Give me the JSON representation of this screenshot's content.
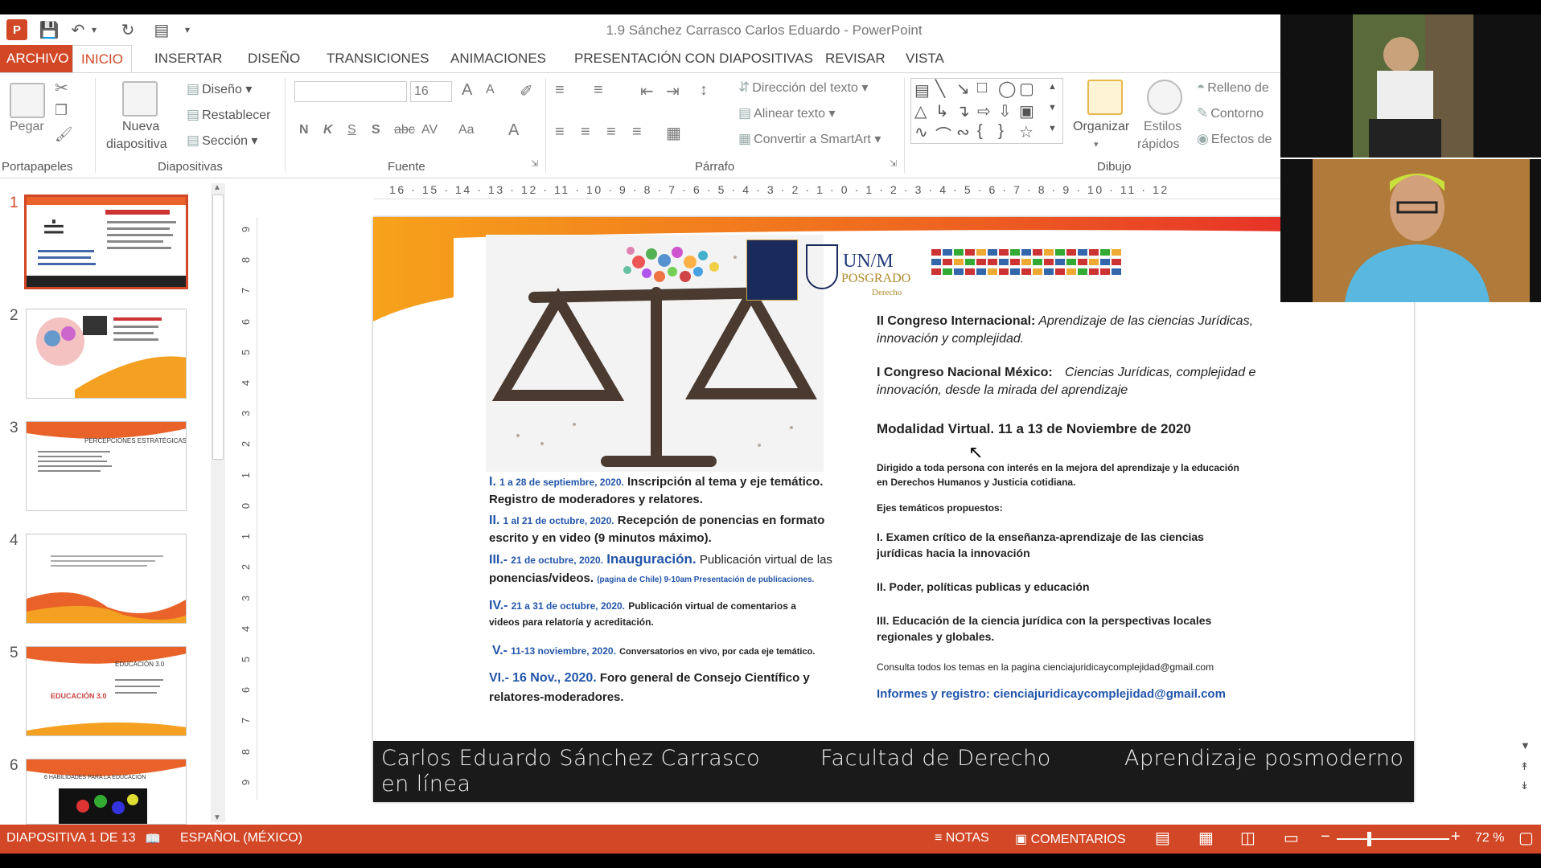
{
  "window": {
    "title": "1.9 Sánchez Carrasco Carlos Eduardo - PowerPoint",
    "app_icon": "P"
  },
  "tabs": [
    {
      "label": "ARCHIVO"
    },
    {
      "label": "INICIO"
    },
    {
      "label": "INSERTAR"
    },
    {
      "label": "DISEÑO"
    },
    {
      "label": "TRANSICIONES"
    },
    {
      "label": "ANIMACIONES"
    },
    {
      "label": "PRESENTACIÓN CON DIAPOSITIVAS"
    },
    {
      "label": "REVISAR"
    },
    {
      "label": "VISTA"
    }
  ],
  "ribbon": {
    "clipboard": {
      "paste": "Pegar",
      "label": "Portapapeles"
    },
    "slides": {
      "new_slide": "Nueva",
      "new_slide2": "diapositiva",
      "layout": "Diseño",
      "reset": "Restablecer",
      "section": "Sección",
      "label": "Diapositivas"
    },
    "font": {
      "size": "16",
      "bold": "N",
      "italic": "K",
      "underline": "S",
      "shadow": "S",
      "strike": "abc",
      "spacing": "AV",
      "case": "Aa",
      "color": "A",
      "grow": "A",
      "shrink": "A",
      "label": "Fuente"
    },
    "paragraph": {
      "text_direction": "Dirección del texto",
      "align_text": "Alinear texto",
      "smartart": "Convertir a SmartArt",
      "label": "Párrafo"
    },
    "drawing": {
      "arrange": "Organizar",
      "quick_styles": "Estilos",
      "quick_styles2": "rápidos",
      "fill": "Relleno de",
      "outline": "Contorno",
      "effects": "Efectos de",
      "label": "Dibujo"
    }
  },
  "ruler": {
    "horizontal": "16 · 15 · 14 · 13 · 12 · 11 · 10 · 9 · 8 · 7 · 6 · 5 · 4 · 3 · 2 · 1 · 0 · 1 · 2 · 3 · 4 · 5 · 6 · 7 · 8 · 9 · 10 · 11 · 12",
    "vertical": [
      "9",
      "8",
      "7",
      "6",
      "5",
      "4",
      "3",
      "2",
      "1",
      "0",
      "1",
      "2",
      "3",
      "4",
      "5",
      "6",
      "7",
      "8",
      "9"
    ]
  },
  "thumbnails": [
    {
      "num": "1"
    },
    {
      "num": "2"
    },
    {
      "num": "3"
    },
    {
      "num": "4"
    },
    {
      "num": "5"
    },
    {
      "num": "6"
    }
  ],
  "thumb_text": {
    "t3_title": "PERCEPCIONES ESTRATÉGICAS",
    "t5_title": "EDUCACIÓN 3.0",
    "t5_word": "EDUCACIÓN 3.0",
    "t6_title": "6 HABILIDADES PARA LA EDUCACIÓN"
  },
  "slide": {
    "logos": {
      "unam": "UN/M",
      "posgrado": "POSGRADO",
      "derecho": "Derecho"
    },
    "right": {
      "l1_bold": "II Congreso Internacional:",
      "l1_it": " Aprendizaje de las ciencias Jurídicas,",
      "l1_it2": "innovación y complejidad.",
      "l2_bold": "I Congreso Nacional México:",
      "l2_it": "Ciencias Jurídicas, complejidad e",
      "l2_it2": "innovación, desde la mirada del aprendizaje",
      "l3": "Modalidad Virtual. 11 a 13 de Noviembre de 2020",
      "l4a": "Dirigido a toda persona con interés en la mejora del aprendizaje y la educación",
      "l4b": "en Derechos Humanos y Justicia cotidiana.",
      "l5": "Ejes temáticos propuestos:",
      "l6a": "I. Examen crítico de la enseñanza-aprendizaje de las ciencias",
      "l6b": "jurídicas hacia la innovación",
      "l7": "II. Poder, políticas publicas y educación",
      "l8a": "III. Educación de la ciencia jurídica con la perspectivas locales",
      "l8b": "regionales y globales.",
      "l9": "Consulta todos los temas en la pagina cienciajuridicaycomplejidad@gmail.com",
      "l10": "Informes y registro: cienciajuridicaycomplejidad@gmail.com"
    },
    "left": {
      "i1_num": "I.",
      "i1_date": "1 a 28 de septiembre, 2020.",
      "i1_text": "Inscripción al tema y eje temático.",
      "i1_text2": "Registro de moderadores y relatores.",
      "i2_num": "II.",
      "i2_date": "1 al 21 de octubre, 2020.",
      "i2_text": "Recepción de ponencias en formato",
      "i2_text2": "escrito y en video (9 minutos máximo).",
      "i3_num": "III.-",
      "i3_date": "21 de octubre, 2020.",
      "i3_big": "Inauguración.",
      "i3_text": "Publicación virtual de las",
      "i3_text2": "ponencias/videos.",
      "i3_small": "(pagina de Chile) 9-10am Presentación de publicaciones.",
      "i4_num": "IV.-",
      "i4_date": "21 a 31 de octubre, 2020.",
      "i4_text": "Publicación virtual de comentarios a",
      "i4_text2": "videos para relatoría y acreditación.",
      "i5_num": "V.-",
      "i5_date": "11-13 noviembre, 2020.",
      "i5_text": "Conversatorios en vivo, por cada eje temático.",
      "i6_num": "VI.-",
      "i6_date": "16 Nov., 2020.",
      "i6_text": "Foro general de Consejo Científico y",
      "i6_text2": "relatores-moderadores."
    },
    "footer": {
      "name1": "Carlos Eduardo Sánchez Carrasco",
      "name2": "en línea",
      "faculty": "Facultad de Derecho",
      "subject": "Aprendizaje posmoderno"
    }
  },
  "status": {
    "slide_count": "DIAPOSITIVA 1 DE 13",
    "language": "ESPAÑOL (MÉXICO)",
    "notes": "NOTAS",
    "comments": "COMENTARIOS",
    "zoom": "72 %"
  },
  "colors": {
    "accent": "#d24726"
  }
}
